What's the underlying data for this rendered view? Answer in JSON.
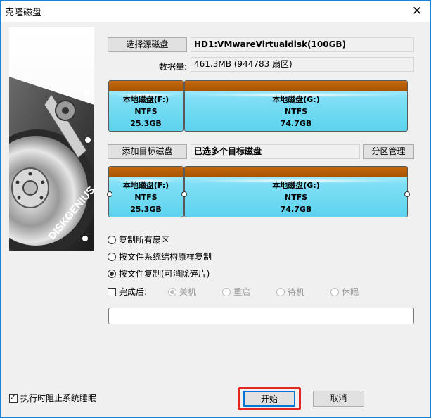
{
  "window": {
    "title": "克隆磁盘",
    "close": "✕"
  },
  "side_image": {
    "brand": "DISKGENIUS"
  },
  "source": {
    "select_button": "选择源磁盘",
    "disk_name": "HD1:VMwareVirtualdisk(100GB)",
    "size_label": "数据量:",
    "size_value": "461.3MB (944783 扇区)",
    "partitions": [
      {
        "name": "本地磁盘(F:)",
        "fs": "NTFS",
        "size": "25.3GB"
      },
      {
        "name": "本地磁盘(G:)",
        "fs": "NTFS",
        "size": "74.7GB"
      }
    ]
  },
  "target": {
    "add_button": "添加目标磁盘",
    "selected_text": "已选多个目标磁盘",
    "partition_button": "分区管理",
    "partitions": [
      {
        "name": "本地磁盘(F:)",
        "fs": "NTFS",
        "size": "25.3GB"
      },
      {
        "name": "本地磁盘(G:)",
        "fs": "NTFS",
        "size": "74.7GB"
      }
    ]
  },
  "options": {
    "copy_all": "复制所有扇区",
    "copy_structure": "按文件系统结构原样复制",
    "copy_files": "按文件复制(可消除碎片)",
    "after_label": "完成后:",
    "after_opts": [
      "关机",
      "重启",
      "待机",
      "休眠"
    ]
  },
  "footer": {
    "prevent_sleep": "执行时阻止系统睡眠",
    "start": "开始",
    "cancel": "取消"
  }
}
